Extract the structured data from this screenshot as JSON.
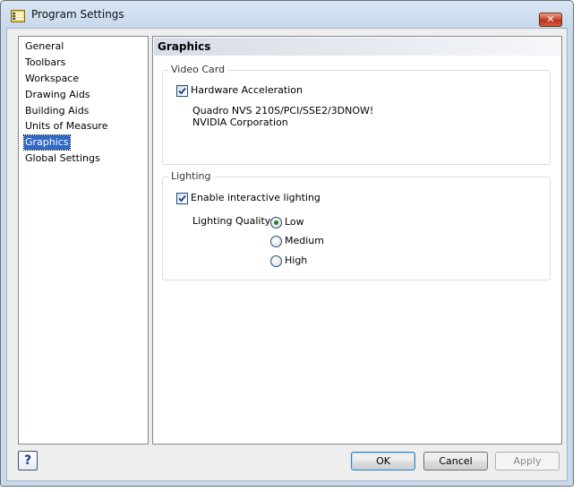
{
  "window": {
    "title": "Program Settings",
    "close_label": "✕"
  },
  "nav": {
    "items": [
      "General",
      "Toolbars",
      "Workspace",
      "Drawing Aids",
      "Building Aids",
      "Units of Measure",
      "Graphics",
      "Global Settings"
    ],
    "selected": "Graphics"
  },
  "panel": {
    "header": "Graphics",
    "video_card": {
      "label": "Video Card",
      "hw_accel_label": "Hardware Acceleration",
      "hw_accel_checked": true,
      "card_line1": "Quadro NVS 210S/PCI/SSE2/3DNOW!",
      "card_line2": "NVIDIA Corporation"
    },
    "lighting": {
      "label": "Lighting",
      "interactive_label": "Enable interactive lighting",
      "interactive_checked": true,
      "quality_label": "Lighting Quality:",
      "options": [
        "Low",
        "Medium",
        "High"
      ],
      "selected": "Low"
    }
  },
  "buttons": {
    "help": "?",
    "ok": "OK",
    "cancel": "Cancel",
    "apply": "Apply"
  },
  "colors": {
    "selection": "#3169c6",
    "radio_dot": "#2d7b25"
  }
}
